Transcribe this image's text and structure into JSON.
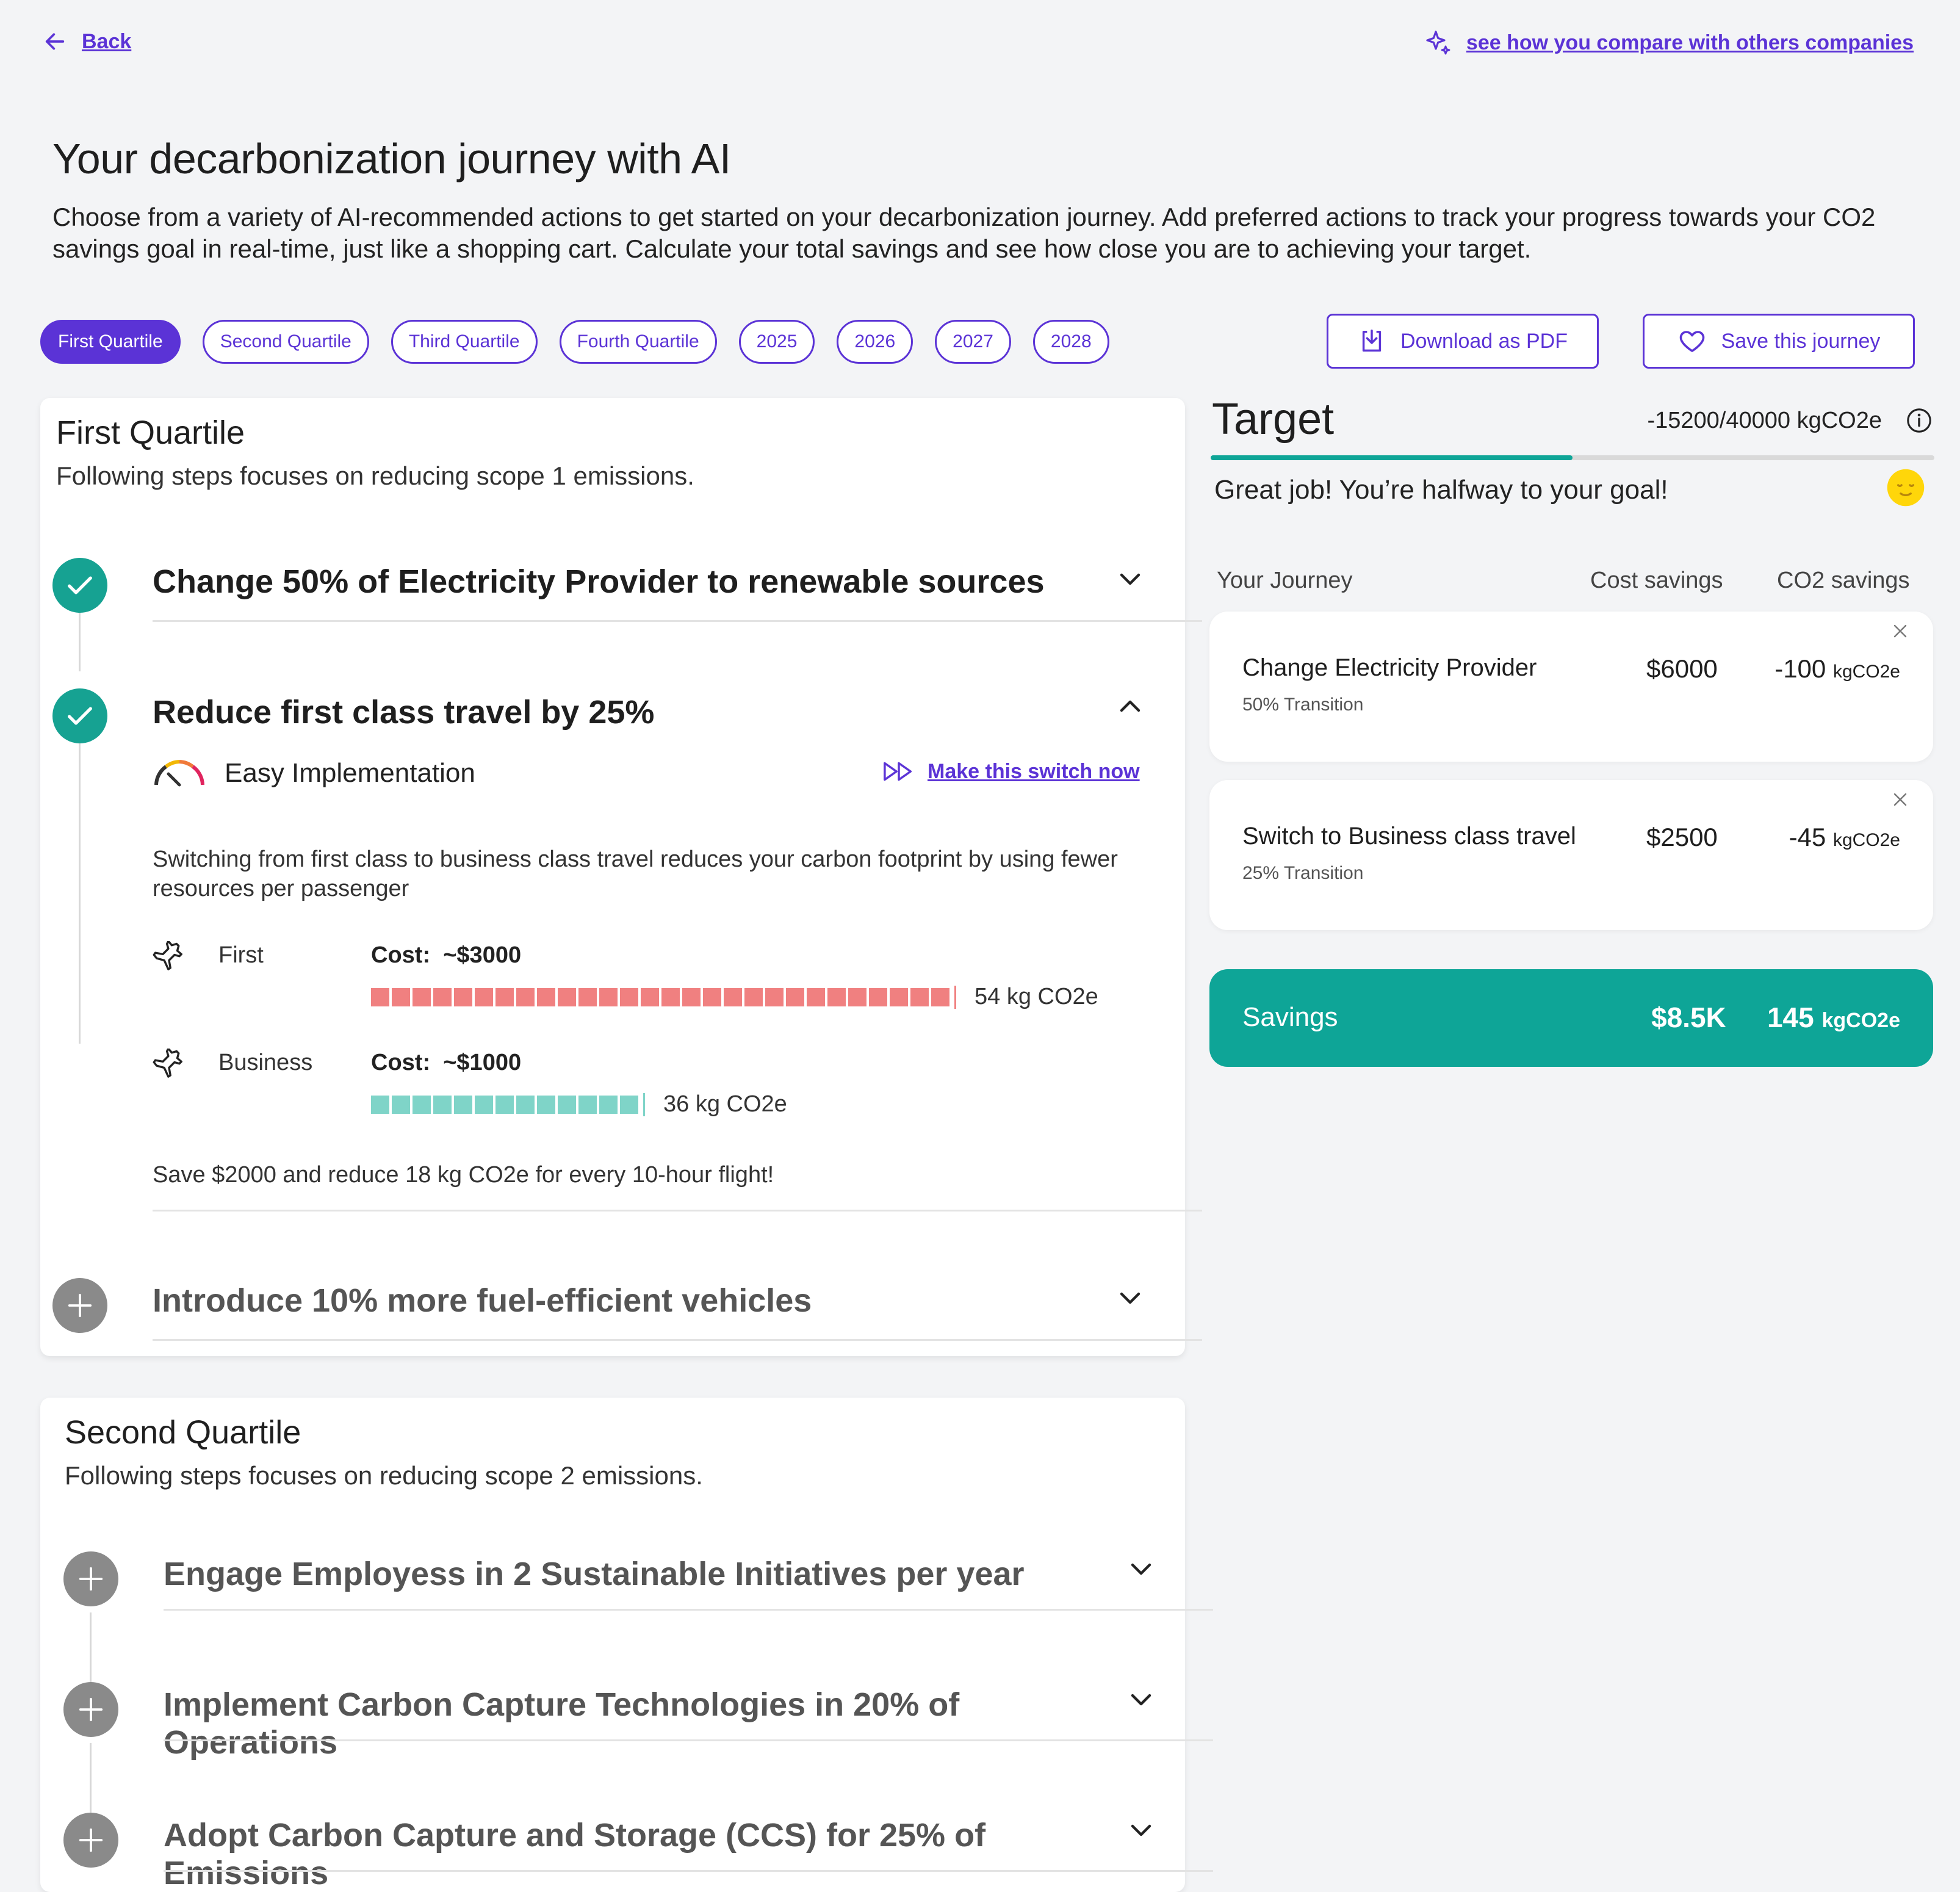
{
  "nav": {
    "back": "Back",
    "compare": "see how you compare with others companies"
  },
  "page": {
    "title": "Your decarbonization journey with AI",
    "description": "Choose from a variety of AI-recommended actions to get started on your decarbonization journey. Add preferred actions to track your progress towards your CO2 savings goal in real-time, just like a shopping cart. Calculate your total savings and see how close you are to achieving your target."
  },
  "filters": [
    "First Quartile",
    "Second Quartile",
    "Third Quartile",
    "Fourth Quartile",
    "2025",
    "2026",
    "2027",
    "2028"
  ],
  "actions": {
    "download": "Download as PDF",
    "save": "Save this journey"
  },
  "first_quartile": {
    "title": "First Quartile",
    "subtitle": "Following steps focuses on reducing scope 1 emissions.",
    "steps": [
      {
        "title": "Change 50% of Electricity Provider to renewable sources",
        "state": "done"
      },
      {
        "title": "Reduce first class travel by 25%",
        "state": "done"
      },
      {
        "title": "Introduce 10% more fuel-efficient vehicles",
        "state": "add"
      }
    ],
    "detail": {
      "implementation": "Easy Implementation",
      "switch_now": "Make this switch now",
      "description": "Switching from first class to business class travel reduces your carbon footprint by using fewer resources per passenger",
      "options": [
        {
          "label": "First",
          "cost_label": "Cost:",
          "cost": "~$3000",
          "emissions": "54 kg CO2e",
          "value_kg": 54,
          "color": "#f08080"
        },
        {
          "label": "Business",
          "cost_label": "Cost:",
          "cost": "~$1000",
          "emissions": "36 kg CO2e",
          "value_kg": 36,
          "color": "#7fd4c8"
        }
      ],
      "summary": "Save $2000 and reduce 18 kg CO2e for every 10-hour flight!"
    }
  },
  "second_quartile": {
    "title": "Second Quartile",
    "subtitle": "Following steps focuses on reducing scope 2 emissions.",
    "steps": [
      {
        "title": "Engage Employess in 2 Sustainable Initiatives per year"
      },
      {
        "title": "Implement Carbon Capture Technologies in 20% of Operations"
      },
      {
        "title": "Adopt Carbon Capture and Storage (CCS) for 25% of Emissions"
      }
    ]
  },
  "target": {
    "title": "Target",
    "progress_text": "-15200/40000 kgCO2e",
    "progress_fraction": 0.5,
    "message": "Great job! You’re halfway to your goal!",
    "headers": {
      "journey": "Your Journey",
      "cost": "Cost savings",
      "co2": "CO2 savings"
    },
    "items": [
      {
        "title": "Change Electricity Provider",
        "sub": "50% Transition",
        "cost": "$6000",
        "co2": "-100",
        "unit": "kgCO2e"
      },
      {
        "title": "Switch to Business class travel",
        "sub": "25% Transition",
        "cost": "$2500",
        "co2": "-45",
        "unit": "kgCO2e"
      }
    ],
    "savings": {
      "label": "Savings",
      "cost": "$8.5K",
      "co2": "145",
      "unit": "kgCO2e"
    }
  },
  "colors": {
    "accent": "#5b33d6",
    "teal": "#0ea597",
    "check": "#16a292",
    "plus": "#8a8a8a"
  }
}
